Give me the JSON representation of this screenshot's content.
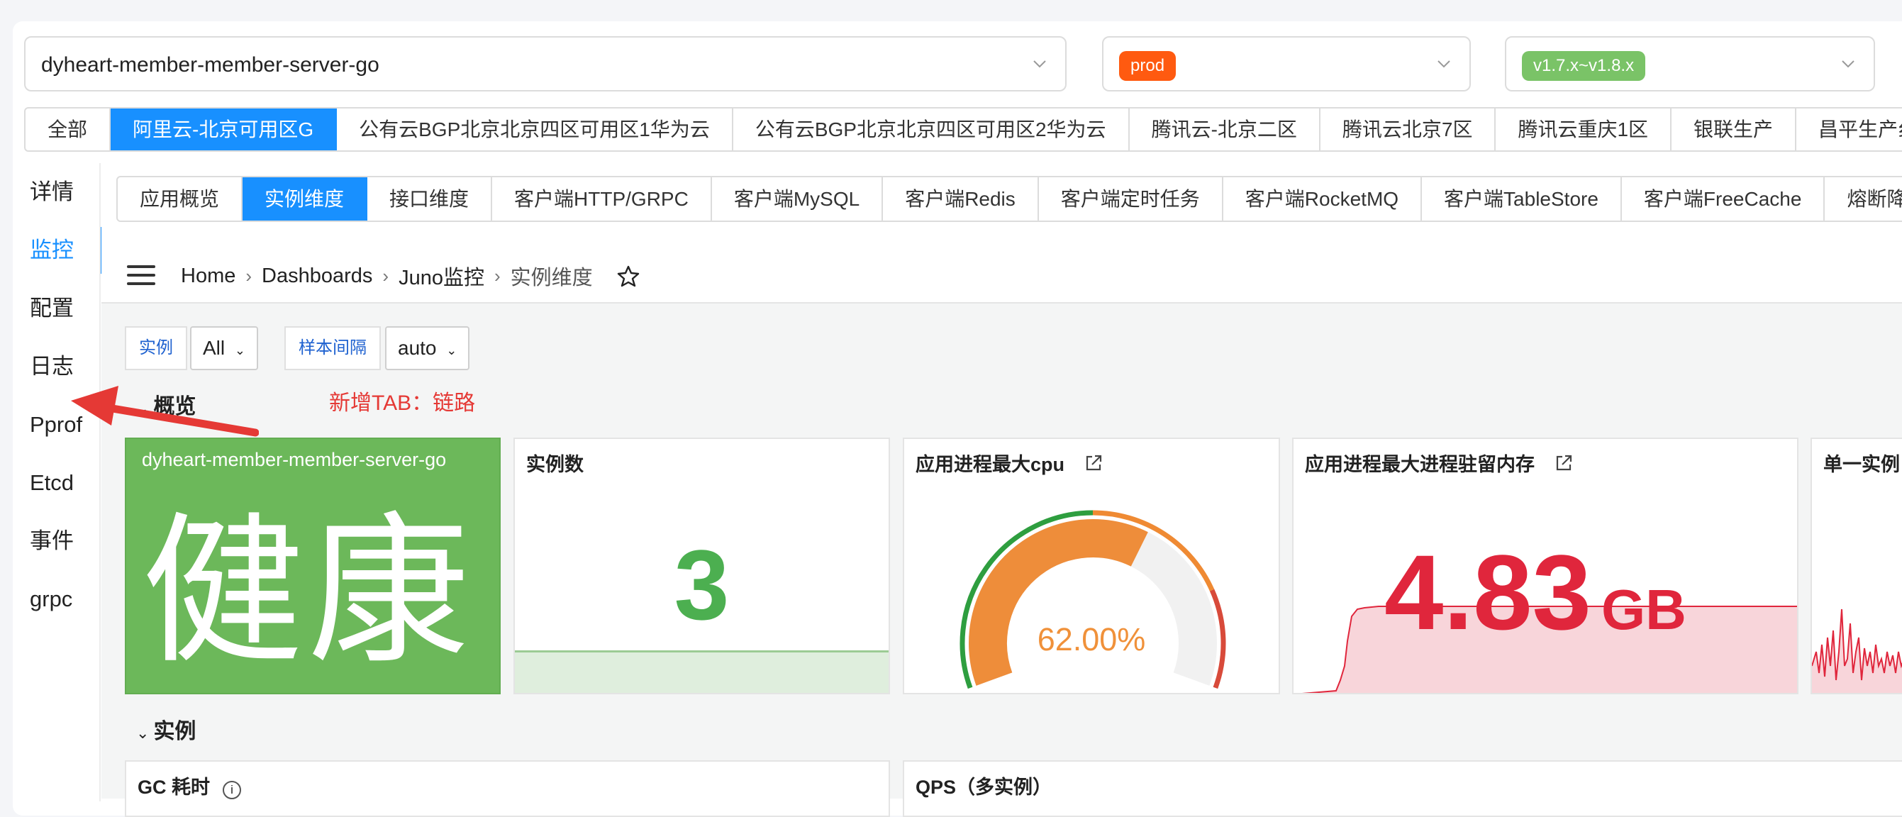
{
  "service_select": {
    "value": "dyheart-member-member-server-go"
  },
  "env_select": {
    "tag": "prod",
    "tag_color": "#ff5a10"
  },
  "version_select": {
    "tag": "v1.7.x~v1.8.x",
    "tag_color": "#7ac367"
  },
  "region_tabs": [
    "全部",
    "阿里云-北京可用区G",
    "公有云BGP北京北京四区可用区1华为云",
    "公有云BGP北京北京四区可用区2华为云",
    "腾讯云-北京二区",
    "腾讯云北京7区",
    "腾讯云重庆1区",
    "银联生产",
    "昌平生产纟"
  ],
  "region_active": "阿里云-北京可用区G",
  "side_nav": [
    "详情",
    "监控",
    "配置",
    "日志",
    "Pprof",
    "Etcd",
    "事件",
    "grpc"
  ],
  "side_active": "监控",
  "sub_tabs": [
    "应用概览",
    "实例维度",
    "接口维度",
    "客户端HTTP/GRPC",
    "客户端MySQL",
    "客户端Redis",
    "客户端定时任务",
    "客户端RocketMQ",
    "客户端TableStore",
    "客户端FreeCache",
    "熔断降纟"
  ],
  "sub_active": "实例维度",
  "breadcrumb": [
    "Home",
    "Dashboards",
    "Juno监控",
    "实例维度"
  ],
  "variables": {
    "instance_label": "实例",
    "instance_value": "All",
    "interval_label": "样本间隔",
    "interval_value": "auto"
  },
  "rows": {
    "overview": "概览",
    "instances": "实例"
  },
  "annotation": "新增TAB：链路",
  "panels": {
    "health": {
      "name": "dyheart-member-member-server-go",
      "status": "健康",
      "color": "#6cb85a"
    },
    "instance_count": {
      "title": "实例数",
      "value": "3"
    },
    "cpu": {
      "title": "应用进程最大cpu",
      "value": "62.00%",
      "percent": 0.62
    },
    "memory": {
      "title": "应用进程最大进程驻留内存",
      "value": "4.83",
      "unit": "GB"
    },
    "single": {
      "title": "单一实例"
    }
  },
  "bottom_panels": {
    "gc": "GC 耗时",
    "qps": "QPS（多实例）"
  }
}
